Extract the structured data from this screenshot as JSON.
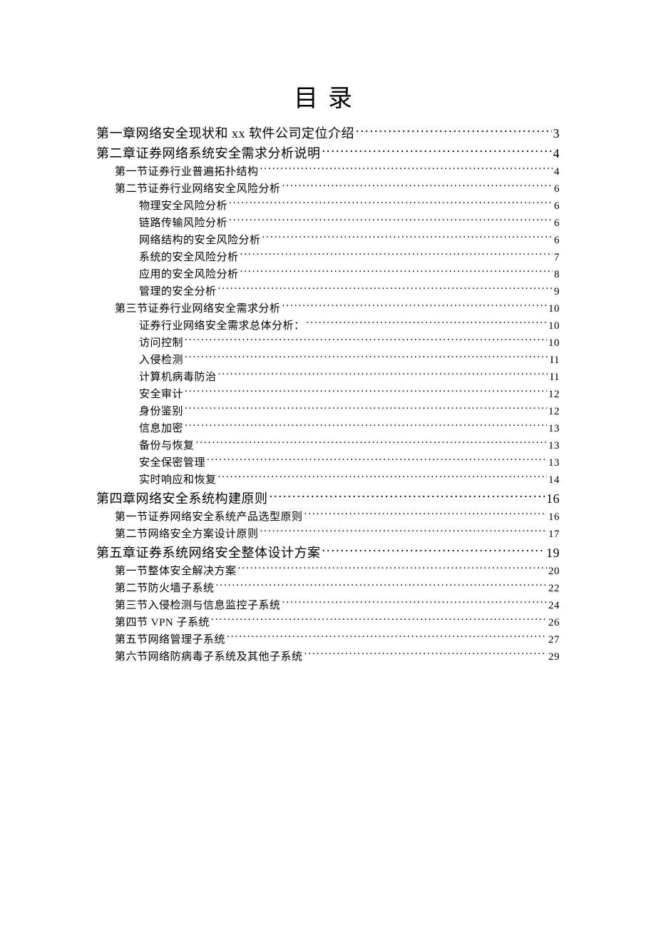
{
  "title": "目录",
  "entries": [
    {
      "level": 1,
      "text": "第一章网络安全现状和 xx 软件公司定位介绍",
      "page": "3"
    },
    {
      "level": 1,
      "text": "第二章证券网络系统安全需求分析说明",
      "page": "4"
    },
    {
      "level": 2,
      "text": "第一节证券行业普遍拓扑结构",
      "page": "4"
    },
    {
      "level": 2,
      "text": "第二节证券行业网络安全风险分析",
      "page": "6"
    },
    {
      "level": 3,
      "text": "物理安全风险分析",
      "page": "6"
    },
    {
      "level": 3,
      "text": "链路传输风险分析",
      "page": "6"
    },
    {
      "level": 3,
      "text": "网络结构的安全风险分析",
      "page": "6"
    },
    {
      "level": 3,
      "text": "系统的安全风险分析",
      "page": "7"
    },
    {
      "level": 3,
      "text": "应用的安全风险分析",
      "page": "8"
    },
    {
      "level": 3,
      "text": "管理的安全分析",
      "page": "9"
    },
    {
      "level": 2,
      "text": "第三节证券行业网络安全需求分析",
      "page": "10"
    },
    {
      "level": 3,
      "text": "证券行业网络安全需求总体分析：",
      "page": "10"
    },
    {
      "level": 3,
      "text": "访问控制",
      "page": "10"
    },
    {
      "level": 3,
      "text": "入侵检测",
      "page": "I1"
    },
    {
      "level": 3,
      "text": "计算机病毒防治",
      "page": "I1"
    },
    {
      "level": 3,
      "text": "安全审计",
      "page": "12"
    },
    {
      "level": 3,
      "text": "身份鉴别",
      "page": "12"
    },
    {
      "level": 3,
      "text": "信息加密",
      "page": "13"
    },
    {
      "level": 3,
      "text": "备份与恢复",
      "page": "13"
    },
    {
      "level": 3,
      "text": "安全保密管理",
      "page": "13"
    },
    {
      "level": 3,
      "text": "实时响应和恢复",
      "page": "14"
    },
    {
      "level": 1,
      "text": "第四章网络安全系统构建原则",
      "page": "16"
    },
    {
      "level": 2,
      "text": "第一节证券网络安全系统产品选型原则",
      "page": "16"
    },
    {
      "level": 2,
      "text": "第二节网络安全方案设计原则",
      "page": "17"
    },
    {
      "level": 1,
      "text": "第五章证券系统网络安全整体设计方案",
      "page": "19"
    },
    {
      "level": 2,
      "text": "第一节整体安全解决方案",
      "page": "20"
    },
    {
      "level": 2,
      "text": "第二节防火墙子系统",
      "page": "22"
    },
    {
      "level": 2,
      "text": "第三节入侵检测与信息监控子系统",
      "page": "24"
    },
    {
      "level": 2,
      "text": "第四节 VPN 子系统",
      "page": "26"
    },
    {
      "level": 2,
      "text": "第五节网络管理子系统",
      "page": "27"
    },
    {
      "level": 2,
      "text": "第六节网络防病毒子系统及其他子系统",
      "page": "29"
    }
  ]
}
